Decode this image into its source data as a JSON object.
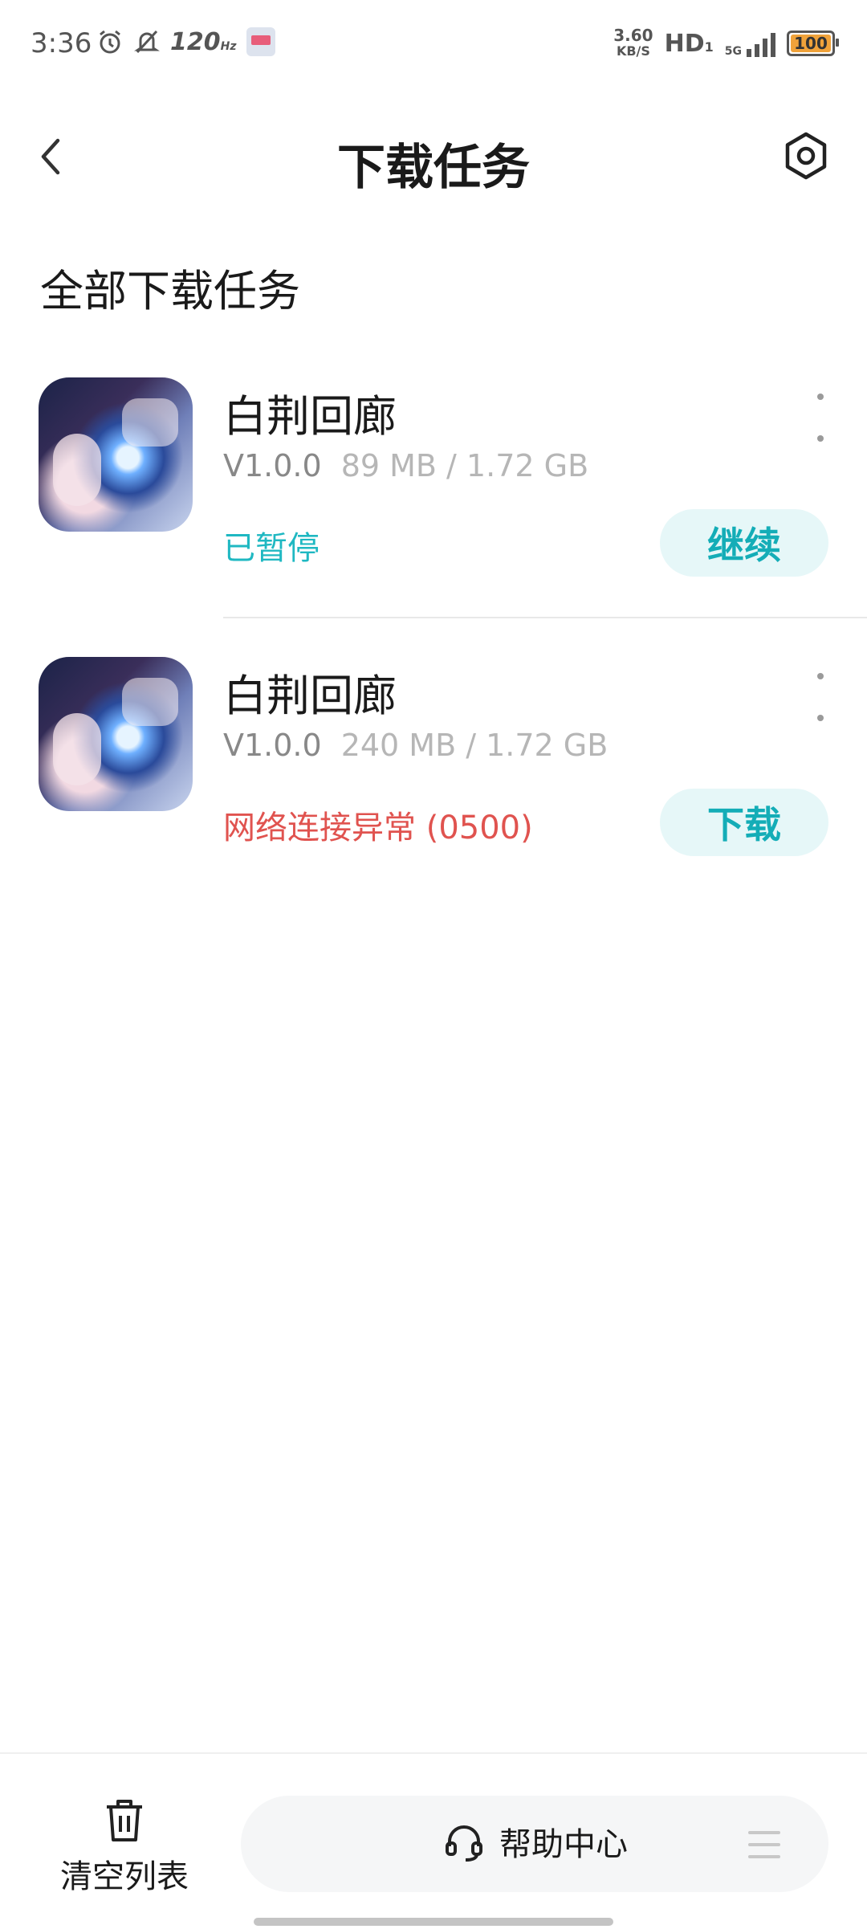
{
  "status_bar": {
    "time": "3:36",
    "refresh_rate": "120",
    "refresh_unit": "Hz",
    "net_speed_value": "3.60",
    "net_speed_unit": "KB/S",
    "hd_label": "HD",
    "hd_sub": "1",
    "network_type": "5G",
    "battery": "100",
    "battery_color": "#f0a23a"
  },
  "header": {
    "title": "下载任务",
    "back_icon": "chevron-left-icon",
    "settings_icon": "hexagon-settings-icon"
  },
  "section_title": "全部下载任务",
  "tasks": [
    {
      "name": "白荆回廊",
      "version": "V1.0.0",
      "size": "89 MB / 1.72 GB",
      "status": "已暂停",
      "action": "继续"
    },
    {
      "name": "白荆回廊",
      "version": "V1.0.0",
      "size": "240 MB / 1.72 GB",
      "status": "网络连接异常 (0500)",
      "action": "下载"
    }
  ],
  "colors": {
    "accent": "#14adb7",
    "accent_bg": "#e6f7f8",
    "error": "#e0534f"
  },
  "bottom_bar": {
    "clear_label": "清空列表",
    "help_label": "帮助中心"
  }
}
